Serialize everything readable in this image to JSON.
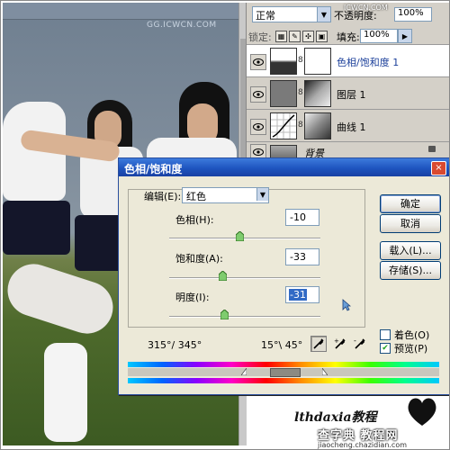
{
  "canvas": {
    "watermark": "GG.ICWCN.COM"
  },
  "layers_panel": {
    "blend_mode": "正常",
    "opacity_label": "不透明度:",
    "opacity_value": "100%",
    "lock_label": "锁定:",
    "fill_label": "填充:",
    "fill_value": "100%",
    "top_watermark": "ICWCN.COM",
    "layers": [
      {
        "name": "色相/饱和度 1",
        "active": true,
        "icon": "adjustment-mask"
      },
      {
        "name": "图层 1",
        "active": false,
        "icon": "solid-gray"
      },
      {
        "name": "曲线 1",
        "active": false,
        "icon": "curves"
      },
      {
        "name": "背景",
        "active": false,
        "icon": "photo",
        "locked": true
      }
    ]
  },
  "dialog": {
    "title": "色相/饱和度",
    "close": "×",
    "edit_label": "编辑(E):",
    "edit_value": "红色",
    "hue_label": "色相(H):",
    "hue_value": "-10",
    "saturation_label": "饱和度(A):",
    "saturation_value": "-33",
    "lightness_label": "明度(I):",
    "lightness_value": "-31",
    "buttons": {
      "ok": "确定",
      "cancel": "取消",
      "load": "载入(L)...",
      "save": "存储(S)..."
    },
    "colorize_label": "着色(O)",
    "colorize_checked": false,
    "preview_label": "预览(P)",
    "preview_checked": true,
    "range_left": "315°/ 345°",
    "range_right": "15°\\ 45°",
    "icons": [
      "eyedropper-icon",
      "eyedropper-plus-icon",
      "eyedropper-minus-icon"
    ],
    "accent_color": "#1e54bf"
  },
  "watermark": {
    "signature": "lthdaxia教程",
    "site": "查字典 教程网",
    "url": "jiaocheng.chazidian.com"
  }
}
